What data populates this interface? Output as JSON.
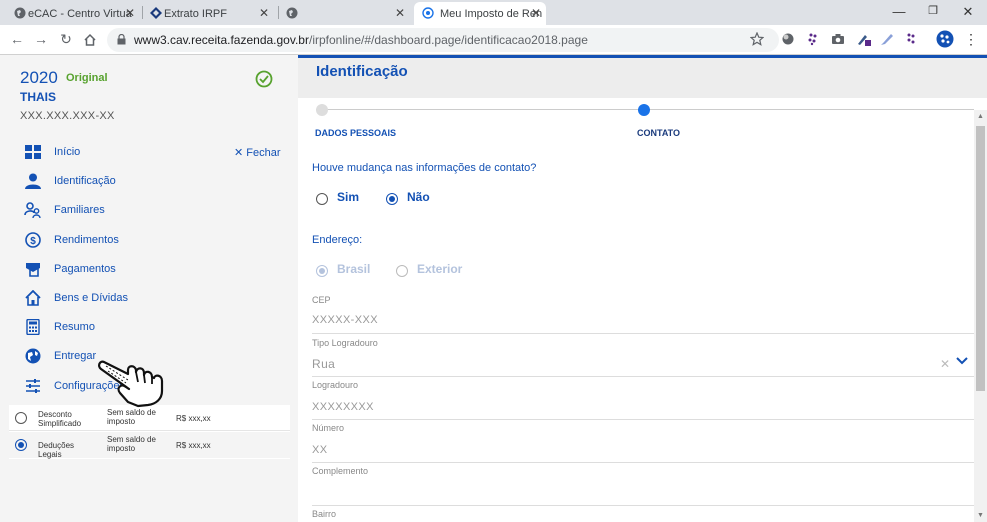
{
  "browser": {
    "tabs": [
      {
        "title": "eCAC - Centro Virtua"
      },
      {
        "title": "Extrato IRPF"
      },
      {
        "title": ""
      },
      {
        "title": "Meu Imposto de Ren"
      }
    ],
    "url_host": "www3.cav.receita.fazenda.gov.br",
    "url_path": "/irpfonline/#/dashboard.page/identificacao2018.page",
    "window_controls": {
      "minimize": "—",
      "restore": "❐",
      "close": "✕"
    }
  },
  "sidebar": {
    "year": "2020",
    "type": "Original",
    "name": "THAIS",
    "cpf": "XXX.XXX.XXX-XX",
    "close_label": "Fechar",
    "items": [
      {
        "label": "Início",
        "icon": "grid-icon"
      },
      {
        "label": "Identificação",
        "icon": "person-icon"
      },
      {
        "label": "Familiares",
        "icon": "family-icon"
      },
      {
        "label": "Rendimentos",
        "icon": "dollar-icon"
      },
      {
        "label": "Pagamentos",
        "icon": "payments-icon"
      },
      {
        "label": "Bens e Dívidas",
        "icon": "house-icon"
      },
      {
        "label": "Resumo",
        "icon": "calculator-icon"
      },
      {
        "label": "Entregar",
        "icon": "globe-icon"
      },
      {
        "label": "Configurações",
        "icon": "sliders-icon"
      }
    ],
    "options": [
      {
        "name": "Desconto Simplificado",
        "status": "Sem saldo de imposto",
        "value": "R$ xxx,xx",
        "selected": false
      },
      {
        "name": "Deduções Legais",
        "status": "Sem saldo de imposto",
        "value": "R$ xxx,xx",
        "selected": true
      }
    ]
  },
  "main": {
    "title": "Identificação",
    "steps": [
      {
        "label": "DADOS PESSOAIS",
        "active": false
      },
      {
        "label": "CONTATO",
        "active": true
      }
    ],
    "question": "Houve mudança nas informações de contato?",
    "answers": [
      {
        "label": "Sim",
        "selected": false
      },
      {
        "label": "Não",
        "selected": true
      }
    ],
    "address_label": "Endereço:",
    "address_options": [
      {
        "label": "Brasil",
        "selected": true
      },
      {
        "label": "Exterior",
        "selected": false
      }
    ],
    "fields": [
      {
        "label": "CEP",
        "value": "XXXXX-XXX"
      },
      {
        "label": "Tipo Logradouro",
        "value": "Rua"
      },
      {
        "label": "Logradouro",
        "value": "XXXXXXXX"
      },
      {
        "label": "Número",
        "value": "XX"
      },
      {
        "label": "Complemento",
        "value": ""
      },
      {
        "label": "Bairro",
        "value": ""
      }
    ]
  },
  "colors": {
    "brand": "#1351b4",
    "accent_green": "#57a22e"
  }
}
